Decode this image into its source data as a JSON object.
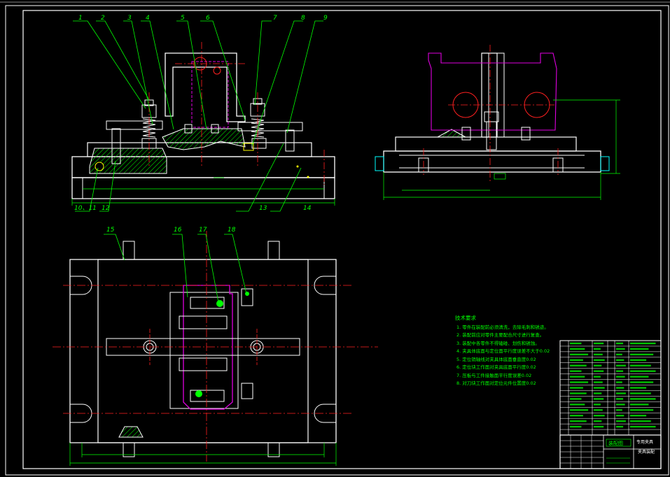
{
  "balloons": {
    "n1": "1",
    "n2": "2",
    "n3": "3",
    "n4": "4",
    "n5": "5",
    "n6": "6",
    "n7": "7",
    "n8": "8",
    "n9": "9",
    "n10_11": "10、11",
    "n12": "12",
    "n13": "13",
    "n14": "14",
    "n15": "15",
    "n16": "16",
    "n17": "17",
    "n18": "18"
  },
  "notes": {
    "heading": "技术要求",
    "lines": [
      "1. 零件在装配前必须清洗，去除毛刺和锈迹。",
      "2. 装配前应对零件主要配合尺寸进行复查。",
      "3. 装配中各零件不得磕碰、划伤和锈蚀。",
      "4. 夹具体底面与定位面平行度误差不大于0.02",
      "5. 定位销轴线对夹具体底面垂直度0.02",
      "6. 定位块工作面对夹具底面平行度0.02",
      "7. 压板与工件接触面平行度误差0.02",
      "8. 对刀块工作面对定位元件位置度0.02"
    ]
  },
  "title_block": {
    "drawing_title": "装配图",
    "product_name": "专用夹具",
    "drawing_label": "夹具装配"
  },
  "colors": {
    "line": "#ffffff",
    "leader": "#00ff00",
    "center": "#ff2020",
    "phantom": "#e000e0",
    "hatch": "#00ff00",
    "dimension": "#00ff00",
    "cyan": "#00ffff",
    "yellow": "#ffff00"
  }
}
